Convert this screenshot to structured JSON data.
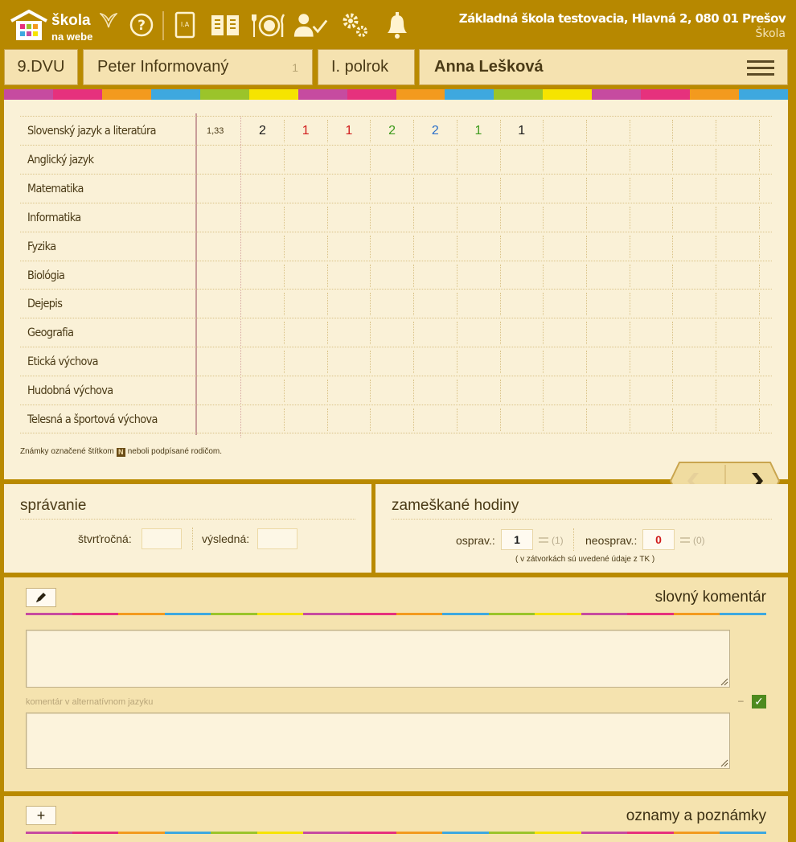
{
  "brand": {
    "line1": "škola",
    "line2": "na webe"
  },
  "topbar_icons": [
    "help-icon",
    "class-book-icon",
    "open-book-icon",
    "canteen-icon",
    "teacher-check-icon",
    "settings-gears-icon",
    "bell-icon"
  ],
  "school": {
    "name": "Základná škola testovacia, Hlavná 2, 080 01 Prešov",
    "type": "Škola"
  },
  "selector": {
    "class": "9.DVU",
    "student": "Peter Informovaný",
    "student_number": "1",
    "term": "I. polrok",
    "teacher": "Anna Lešková"
  },
  "strip_colors": [
    "#c64ba0",
    "#e6317d",
    "#f39a1e",
    "#3ea8df",
    "#9bc42a",
    "#f6e400",
    "#c64ba0",
    "#e6317d",
    "#f39a1e",
    "#3ea8df",
    "#9bc42a",
    "#f6e400",
    "#c64ba0",
    "#e6317d",
    "#f39a1e",
    "#3ea8df"
  ],
  "grades": {
    "subjects": [
      {
        "name": "Slovenský jazyk a literatúra",
        "average": "1,33",
        "marks": [
          {
            "value": "2",
            "color": "#1a1a1a"
          },
          {
            "value": "1",
            "color": "#d01b1b"
          },
          {
            "value": "1",
            "color": "#d01b1b"
          },
          {
            "value": "2",
            "color": "#3d9a1c"
          },
          {
            "value": "2",
            "color": "#2a6fc9"
          },
          {
            "value": "1",
            "color": "#3d9a1c"
          },
          {
            "value": "1",
            "color": "#1a1a1a"
          }
        ]
      },
      {
        "name": "Anglický jazyk",
        "average": "",
        "marks": []
      },
      {
        "name": "Matematika",
        "average": "",
        "marks": []
      },
      {
        "name": "Informatika",
        "average": "",
        "marks": []
      },
      {
        "name": "Fyzika",
        "average": "",
        "marks": []
      },
      {
        "name": "Biológia",
        "average": "",
        "marks": []
      },
      {
        "name": "Dejepis",
        "average": "",
        "marks": []
      },
      {
        "name": "Geografia",
        "average": "",
        "marks": []
      },
      {
        "name": "Etická výchova",
        "average": "",
        "marks": []
      },
      {
        "name": "Hudobná výchova",
        "average": "",
        "marks": []
      },
      {
        "name": "Telesná a športová výchova",
        "average": "",
        "marks": []
      }
    ],
    "footnote_before": "Známky označené štítkom",
    "footnote_badge": "N",
    "footnote_after": "neboli podpísané rodičom."
  },
  "behavior": {
    "title": "správanie",
    "quarterly_label": "štvrťročná:",
    "quarterly_value": "",
    "final_label": "výsledná:",
    "final_value": ""
  },
  "absence": {
    "title": "zameškané hodiny",
    "excused_label": "osprav.:",
    "excused_value": "1",
    "excused_tk": "(1)",
    "unexcused_label": "neosprav.:",
    "unexcused_value": "0",
    "unexcused_tk": "(0)",
    "note": "( v zátvorkách sú uvedené údaje z TK )"
  },
  "comment": {
    "title": "slovný komentár",
    "main_text": "",
    "alt_label": "komentár v alternatívnom jazyku",
    "alt_text": "",
    "dash": "–"
  },
  "notes": {
    "title": "oznamy a poznámky",
    "add_label": "+"
  },
  "colors": {
    "header_bg": "#b78800",
    "panel_bg": "#faf1d7",
    "mark_red": "#d01b1b",
    "mark_green": "#3d9a1c",
    "mark_blue": "#2a6fc9"
  }
}
